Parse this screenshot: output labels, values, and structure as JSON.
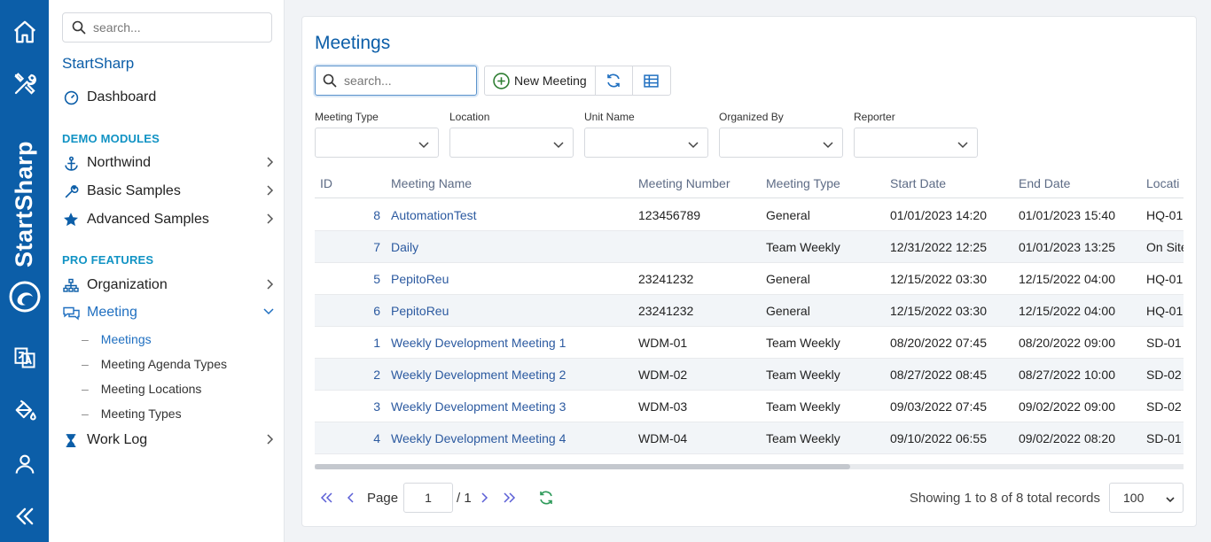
{
  "brand": {
    "vertical_text": "StartSharp",
    "color": "#0c5ea8"
  },
  "nav": {
    "search_placeholder": "search...",
    "app_name": "StartSharp",
    "dashboard": "Dashboard",
    "demo_section": "DEMO MODULES",
    "northwind": "Northwind",
    "basic_samples": "Basic Samples",
    "advanced_samples": "Advanced Samples",
    "pro_section": "PRO FEATURES",
    "organization": "Organization",
    "meeting": "Meeting",
    "meeting_children": [
      "Meetings",
      "Meeting Agenda Types",
      "Meeting Locations",
      "Meeting Types"
    ],
    "work_log": "Work Log",
    "active_child": "Meetings"
  },
  "page": {
    "title": "Meetings",
    "search_placeholder": "search...",
    "new_button": "New Meeting"
  },
  "filters": [
    "Meeting Type",
    "Location",
    "Unit Name",
    "Organized By",
    "Reporter"
  ],
  "grid": {
    "columns": [
      "ID",
      "Meeting Name",
      "Meeting Number",
      "Meeting Type",
      "Start Date",
      "End Date",
      "Locati"
    ],
    "rows": [
      [
        "8",
        "AutomationTest",
        "123456789",
        "General",
        "01/01/2023 14:20",
        "01/01/2023 15:40",
        "HQ-01"
      ],
      [
        "7",
        "Daily",
        "",
        "Team Weekly",
        "12/31/2022 12:25",
        "01/01/2023 13:25",
        "On Site"
      ],
      [
        "5",
        "PepitoReu",
        "23241232",
        "General",
        "12/15/2022 03:30",
        "12/15/2022 04:00",
        "HQ-01"
      ],
      [
        "6",
        "PepitoReu",
        "23241232",
        "General",
        "12/15/2022 03:30",
        "12/15/2022 04:00",
        "HQ-01"
      ],
      [
        "1",
        "Weekly Development Meeting 1",
        "WDM-01",
        "Team Weekly",
        "08/20/2022 07:45",
        "08/20/2022 09:00",
        "SD-01"
      ],
      [
        "2",
        "Weekly Development Meeting 2",
        "WDM-02",
        "Team Weekly",
        "08/27/2022 08:45",
        "08/27/2022 10:00",
        "SD-02"
      ],
      [
        "3",
        "Weekly Development Meeting 3",
        "WDM-03",
        "Team Weekly",
        "09/03/2022 07:45",
        "09/02/2022 09:00",
        "SD-02"
      ],
      [
        "4",
        "Weekly Development Meeting 4",
        "WDM-04",
        "Team Weekly",
        "09/10/2022 06:55",
        "09/02/2022 08:20",
        "SD-01"
      ]
    ]
  },
  "pager": {
    "page_label": "Page",
    "page_value": "1",
    "page_total": "/ 1",
    "status": "Showing 1 to 8 of 8 total records",
    "page_size": "100"
  }
}
